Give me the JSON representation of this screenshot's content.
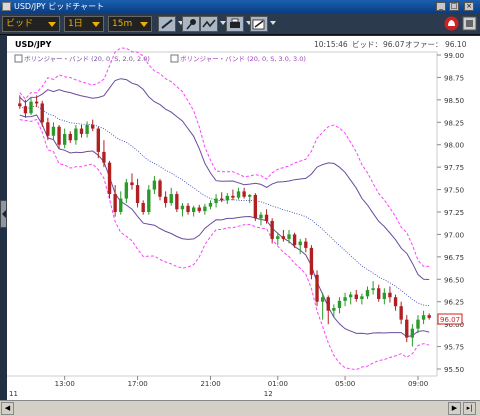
{
  "window": {
    "title": "USD/JPY ビッドチャート",
    "minimize_glyph": "_",
    "maximize_glyph": "□",
    "close_glyph": "×"
  },
  "toolbar": {
    "price_type": "ビッド",
    "period": "1日",
    "interval": "15m",
    "tool_icons": [
      "line-draw-icon",
      "pin-icon",
      "indicator-icon",
      "print-icon",
      "export-icon"
    ],
    "right_icons": [
      "alert-bell-icon",
      "settings-icon"
    ]
  },
  "chart": {
    "symbol": "USD/JPY",
    "time": "10:15:46",
    "bid_label": "ビッド：",
    "bid_value": "96.07",
    "offer_label": "オファー：",
    "offer_value": "96.10",
    "legend": [
      {
        "text": "ボリンジャー・バンド (20, 0, S, 2.0, 2.0)",
        "color": "#7a4fa0"
      },
      {
        "text": "ボリンジャー・バンド (20, 0, S, 3.0, 3.0)",
        "color": "#a040c0"
      }
    ],
    "current_price_label": "96.07",
    "colors": {
      "up": "#2a9a2a",
      "down": "#b02020",
      "band2": "#6a4c9c",
      "band3": "#ff40ff",
      "mid": "#2a3ab8"
    }
  },
  "chart_data": {
    "type": "candlestick",
    "yticks": [
      "99.00",
      "98.75",
      "98.50",
      "98.25",
      "98.00",
      "97.75",
      "97.50",
      "97.25",
      "97.00",
      "96.75",
      "96.50",
      "96.25",
      "96.00",
      "95.75",
      "95.50"
    ],
    "ylim": [
      95.5,
      99.0
    ],
    "xticks": [
      "13:00",
      "17:00",
      "21:00",
      "01:00",
      "05:00",
      "09:00"
    ],
    "day_labels": [
      "11",
      "12"
    ],
    "candles": [
      [
        98.46,
        98.55,
        98.4,
        98.43
      ],
      [
        98.43,
        98.5,
        98.3,
        98.35
      ],
      [
        98.35,
        98.52,
        98.33,
        98.48
      ],
      [
        98.48,
        98.55,
        98.42,
        98.46
      ],
      [
        98.46,
        98.49,
        98.2,
        98.25
      ],
      [
        98.25,
        98.3,
        98.05,
        98.1
      ],
      [
        98.1,
        98.25,
        98.05,
        98.2
      ],
      [
        98.2,
        98.22,
        97.95,
        98.0
      ],
      [
        98.0,
        98.18,
        97.96,
        98.12
      ],
      [
        98.12,
        98.15,
        98.02,
        98.05
      ],
      [
        98.05,
        98.22,
        98.0,
        98.18
      ],
      [
        98.18,
        98.22,
        98.08,
        98.12
      ],
      [
        98.12,
        98.26,
        98.08,
        98.22
      ],
      [
        98.22,
        98.28,
        98.15,
        98.18
      ],
      [
        98.18,
        98.2,
        97.85,
        97.92
      ],
      [
        97.92,
        98.05,
        97.75,
        97.8
      ],
      [
        97.8,
        97.82,
        97.4,
        97.45
      ],
      [
        97.45,
        97.55,
        97.2,
        97.25
      ],
      [
        97.25,
        97.48,
        97.22,
        97.4
      ],
      [
        97.4,
        97.62,
        97.35,
        97.58
      ],
      [
        97.58,
        97.68,
        97.5,
        97.55
      ],
      [
        97.55,
        97.62,
        97.3,
        97.35
      ],
      [
        97.35,
        97.38,
        97.22,
        97.25
      ],
      [
        97.25,
        97.55,
        97.22,
        97.5
      ],
      [
        97.5,
        97.65,
        97.45,
        97.6
      ],
      [
        97.6,
        97.62,
        97.38,
        97.42
      ],
      [
        97.42,
        97.48,
        97.3,
        97.35
      ],
      [
        97.35,
        97.52,
        97.32,
        97.45
      ],
      [
        97.45,
        97.48,
        97.25,
        97.28
      ],
      [
        97.28,
        97.35,
        97.2,
        97.32
      ],
      [
        97.32,
        97.35,
        97.22,
        97.25
      ],
      [
        97.25,
        97.32,
        97.2,
        97.3
      ],
      [
        97.3,
        97.33,
        97.24,
        97.26
      ],
      [
        97.26,
        97.34,
        97.22,
        97.31
      ],
      [
        97.31,
        97.38,
        97.28,
        97.35
      ],
      [
        97.35,
        97.45,
        97.3,
        97.4
      ],
      [
        97.4,
        97.47,
        97.36,
        97.38
      ],
      [
        97.38,
        97.46,
        97.34,
        97.43
      ],
      [
        97.43,
        97.5,
        97.38,
        97.41
      ],
      [
        97.41,
        97.52,
        97.39,
        97.48
      ],
      [
        97.48,
        97.52,
        97.4,
        97.42
      ],
      [
        97.42,
        97.45,
        97.35,
        97.44
      ],
      [
        97.44,
        97.46,
        97.15,
        97.18
      ],
      [
        97.18,
        97.25,
        97.1,
        97.22
      ],
      [
        97.22,
        97.28,
        97.12,
        97.15
      ],
      [
        97.15,
        97.18,
        96.9,
        96.95
      ],
      [
        96.95,
        97.02,
        96.88,
        96.98
      ],
      [
        96.98,
        97.05,
        96.92,
        96.95
      ],
      [
        96.95,
        97.05,
        96.9,
        97.0
      ],
      [
        97.0,
        97.02,
        96.85,
        96.88
      ],
      [
        96.88,
        96.95,
        96.78,
        96.92
      ],
      [
        96.92,
        96.96,
        96.8,
        96.85
      ],
      [
        96.85,
        96.88,
        96.5,
        96.55
      ],
      [
        96.55,
        96.6,
        96.2,
        96.25
      ],
      [
        96.25,
        96.35,
        96.05,
        96.3
      ],
      [
        96.3,
        96.32,
        96.0,
        96.15
      ],
      [
        96.15,
        96.22,
        96.08,
        96.18
      ],
      [
        96.18,
        96.3,
        96.12,
        96.26
      ],
      [
        96.26,
        96.35,
        96.2,
        96.3
      ],
      [
        96.3,
        96.36,
        96.22,
        96.33
      ],
      [
        96.33,
        96.38,
        96.25,
        96.28
      ],
      [
        96.28,
        96.34,
        96.22,
        96.31
      ],
      [
        96.31,
        96.42,
        96.28,
        96.38
      ],
      [
        96.38,
        96.48,
        96.33,
        96.4
      ],
      [
        96.4,
        96.44,
        96.25,
        96.28
      ],
      [
        96.28,
        96.4,
        96.22,
        96.35
      ],
      [
        96.35,
        96.42,
        96.24,
        96.3
      ],
      [
        96.3,
        96.33,
        96.15,
        96.2
      ],
      [
        96.2,
        96.25,
        96.0,
        96.05
      ],
      [
        96.05,
        96.1,
        95.8,
        95.85
      ],
      [
        95.85,
        96.0,
        95.75,
        95.95
      ],
      [
        95.95,
        96.1,
        95.9,
        96.05
      ],
      [
        96.05,
        96.15,
        96.0,
        96.1
      ],
      [
        96.1,
        96.12,
        96.05,
        96.07
      ]
    ]
  }
}
